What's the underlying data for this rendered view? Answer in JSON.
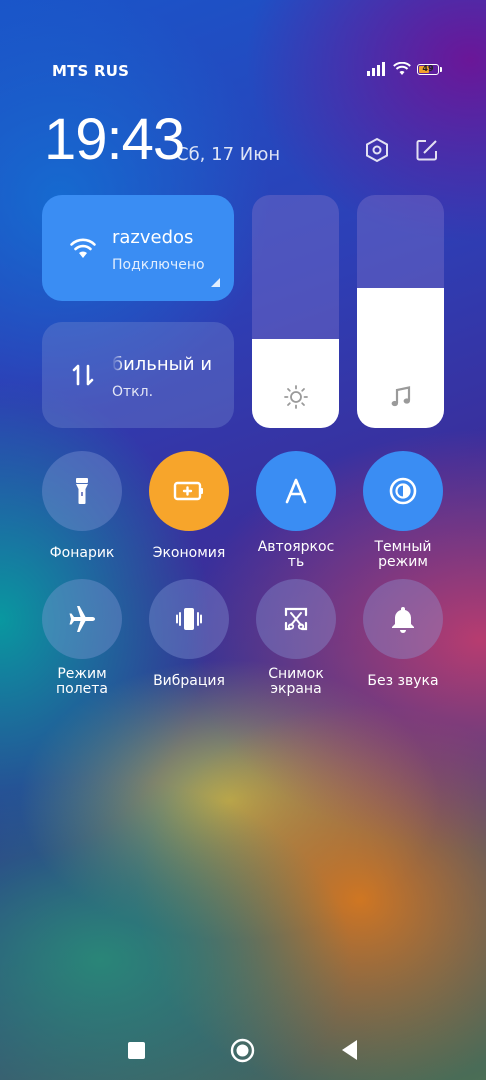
{
  "status": {
    "carrier": "MTS RUS",
    "battery": "49",
    "battery_level": 0.49
  },
  "header": {
    "time": "19:43",
    "date": "Сб, 17 Июн"
  },
  "wifi": {
    "name": "razvedos",
    "status": "Подключено"
  },
  "mobile": {
    "name": "бильный и",
    "status": "Откл."
  },
  "brightness": {
    "level": 0.38
  },
  "volume": {
    "level": 0.6
  },
  "toggles": [
    {
      "label": "Фонарик"
    },
    {
      "label": "Экономия"
    },
    {
      "label": "Автояркос ть"
    },
    {
      "label": "Темный режим"
    },
    {
      "label": "Режим полета"
    },
    {
      "label": "Вибрация"
    },
    {
      "label": "Снимок экрана"
    },
    {
      "label": "Без звука"
    }
  ],
  "colors": {
    "active_blue": "#3a8df3",
    "active_orange": "#f7a52b"
  }
}
